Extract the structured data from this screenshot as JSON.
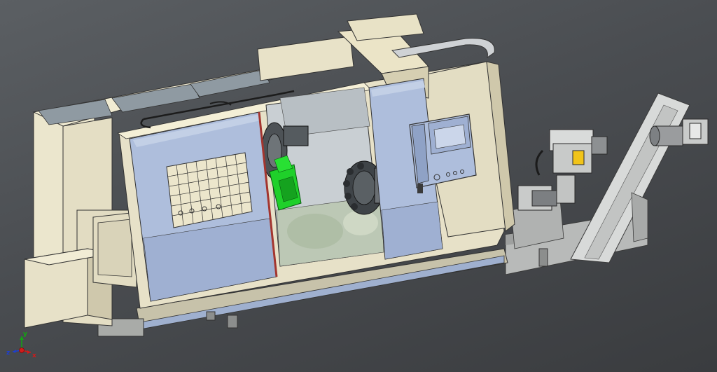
{
  "viewer": {
    "background_top": "#5b5f63",
    "background_bottom": "#3a3c3f"
  },
  "model": {
    "subject": "cnc-turning-lathe-with-chip-conveyor",
    "colors": {
      "housing": "#e7e1c8",
      "housing_shadow": "#c9c2a6",
      "door_panel": "#aebedc",
      "door_panel_dark": "#8fa2c6",
      "turret_green": "#1fd02a",
      "turret_dark": "#3f4448",
      "door_trim_red": "#a3352f",
      "glass": "#cfd6dc",
      "conveyor": "#d4d6d5"
    }
  },
  "triad": {
    "x_label": "x",
    "y_label": "y",
    "z_label": "z",
    "x_color": "#d21a1a",
    "y_color": "#12a512",
    "z_color": "#1d3fd2"
  }
}
